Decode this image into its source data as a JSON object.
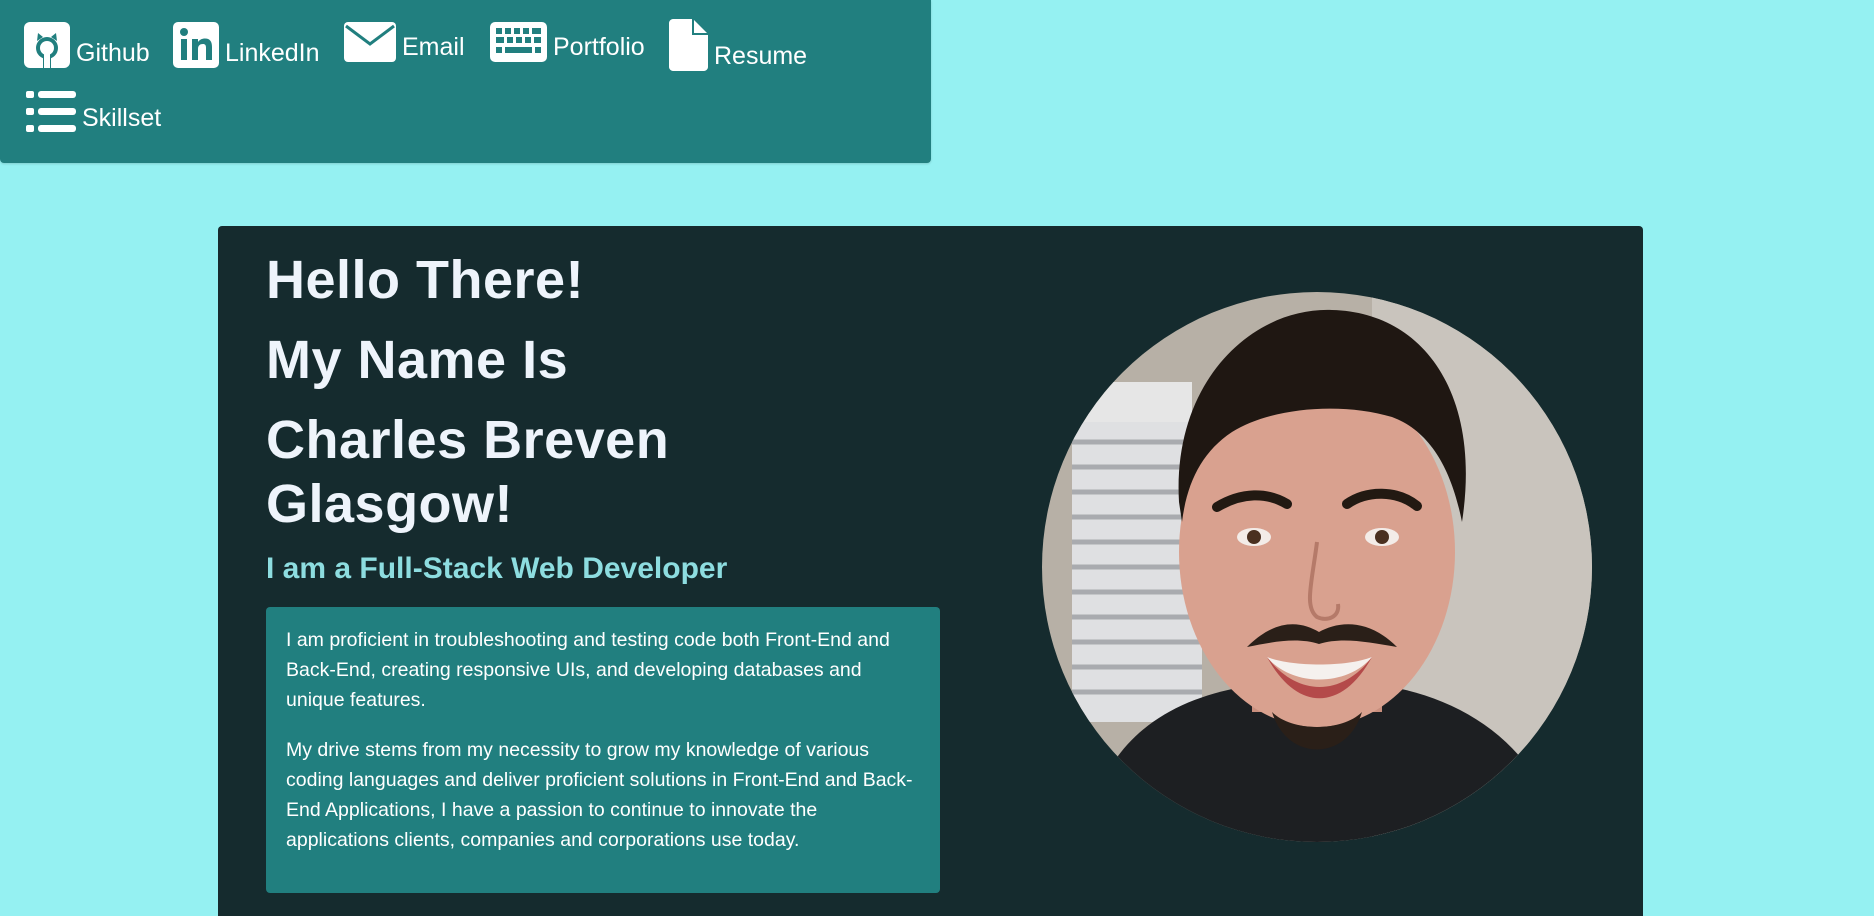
{
  "nav": {
    "links": [
      {
        "label": "Github",
        "icon": "github-icon"
      },
      {
        "label": "LinkedIn",
        "icon": "linkedin-icon"
      },
      {
        "label": "Email",
        "icon": "envelope-icon"
      },
      {
        "label": "Portfolio",
        "icon": "keyboard-icon"
      },
      {
        "label": "Resume",
        "icon": "file-icon"
      },
      {
        "label": "Skillset",
        "icon": "list-icon"
      }
    ]
  },
  "hero": {
    "greeting": "Hello There!",
    "intro": "My Name Is",
    "name": "Charles Breven Glasgow!",
    "tagline": "I am a Full-Stack Web Developer",
    "bio": [
      "I am proficient in troubleshooting and testing code both Front-End and Back-End, creating responsive UIs, and developing databases and unique features.",
      "My drive stems from my necessity to grow my knowledge of various coding languages and deliver proficient solutions in Front-End and Back-End Applications, I have a passion to continue to innovate the applications clients, companies and corporations use today."
    ]
  },
  "colors": {
    "page_bg": "#95f1f2",
    "nav_bg": "#217f7f",
    "hero_bg": "#152b2e",
    "heading": "#eef4fb",
    "tagline": "#8ddde0",
    "bio_bg": "#217f7f"
  }
}
